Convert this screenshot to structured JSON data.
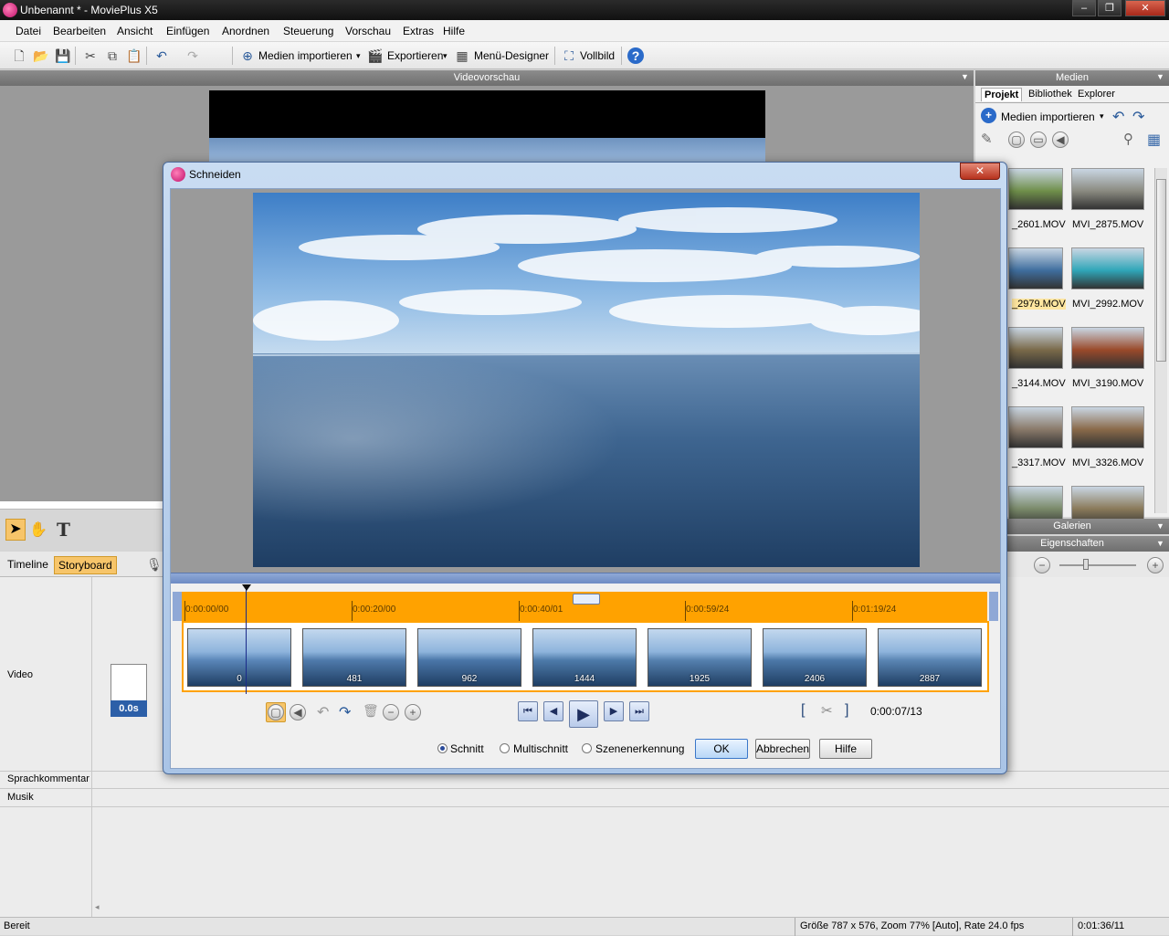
{
  "window": {
    "title": "Unbenannt * - MoviePlus X5",
    "controls": [
      "minimize",
      "restore",
      "close"
    ]
  },
  "menubar": [
    "Datei",
    "Bearbeiten",
    "Ansicht",
    "Einfügen",
    "Anordnen",
    "Steuerung",
    "Vorschau",
    "Extras",
    "Hilfe"
  ],
  "toolbar": {
    "import_label": "Medien importieren",
    "export_label": "Exportieren",
    "menu_designer_label": "Menü-Designer",
    "fullscreen_label": "Vollbild"
  },
  "preview": {
    "header": "Videovorschau"
  },
  "timeline": {
    "tabs": [
      "Timeline",
      "Storyboard"
    ],
    "active_tab": "Storyboard",
    "tracks": [
      "Video",
      "Sprachkommentar",
      "Musik"
    ],
    "clip_duration": "0.0s"
  },
  "media": {
    "header": "Medien",
    "tabs": [
      "Projekt",
      "Bibliothek",
      "Explorer"
    ],
    "active_tab": "Projekt",
    "import_label": "Medien importieren",
    "items": [
      {
        "name": "_2601.MOV",
        "color": "#6f8f4a"
      },
      {
        "name": "MVI_2875.MOV",
        "color": "#8a8a80"
      },
      {
        "name": "_2979.MOV",
        "color": "#3f6e9e",
        "highlighted": true
      },
      {
        "name": "MVI_2992.MOV",
        "color": "#2fa6b8"
      },
      {
        "name": "_3144.MOV",
        "color": "#7a6a4a"
      },
      {
        "name": "MVI_3190.MOV",
        "color": "#9a4a2a"
      },
      {
        "name": "_3317.MOV",
        "color": "#8a7a6a"
      },
      {
        "name": "MVI_3326.MOV",
        "color": "#8a6a4a"
      },
      {
        "name": "",
        "color": "#7a8a6a"
      },
      {
        "name": "",
        "color": "#8a7a5a"
      }
    ],
    "galleries_label": "Galerien",
    "properties_label": "Eigenschaften"
  },
  "dialog": {
    "title": "Schneiden",
    "ruler_labels": [
      "0:00:00/00",
      "0:00:20/00",
      "0:00:40/01",
      "0:00:59/24",
      "0:01:19/24"
    ],
    "frames": [
      "0",
      "481",
      "962",
      "1444",
      "1925",
      "2406",
      "2887"
    ],
    "current_time": "0:00:07/13",
    "modes": [
      "Schnitt",
      "Multischnitt",
      "Szenenerkennung"
    ],
    "selected_mode": "Schnitt",
    "buttons": {
      "ok": "OK",
      "cancel": "Abbrechen",
      "help": "Hilfe"
    }
  },
  "status": {
    "left": "Bereit",
    "info": "Größe 787 x 576, Zoom 77% [Auto], Rate 24.0 fps",
    "time": "0:01:36/11"
  }
}
